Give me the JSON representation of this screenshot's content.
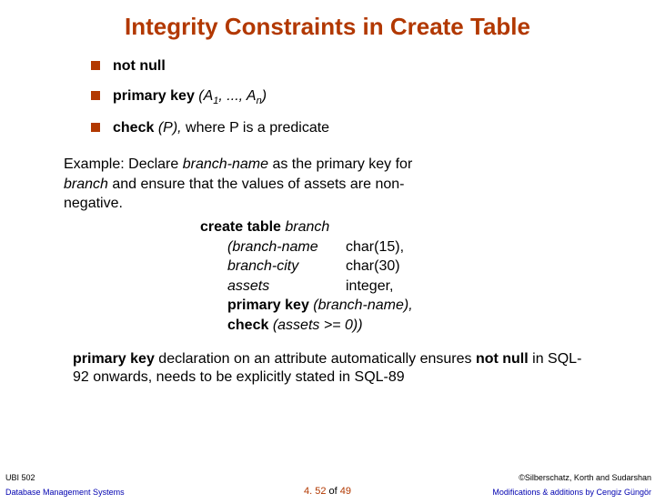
{
  "title": "Integrity Constraints in Create Table",
  "bullets": {
    "b1": "not null",
    "b2_prefix": "primary key ",
    "b2_a": "(A",
    "b2_sub1": "1",
    "b2_mid": ", ..., A",
    "b2_subn": "n",
    "b2_end": ")",
    "b3_prefix": "check ",
    "b3_italic": "(P),",
    "b3_rest": " where P is a predicate"
  },
  "example": {
    "line1_a": "Example:  Declare ",
    "line1_b": "branch-name",
    "line1_c": " as the primary key for ",
    "line2_a": "branch",
    "line2_b": " and ensure that the values of assets are non-",
    "line3": "negative."
  },
  "code": {
    "l1a": "create table ",
    "l1b": "branch",
    "l2a": "(branch-name",
    "l2b": "char(15),",
    "l3a": "branch-city",
    "l3b": "char(30)",
    "l4a": "assets",
    "l4b": "integer,",
    "l5a": "primary key ",
    "l5b": "(branch-name),",
    "l6a": "check ",
    "l6b": "(assets >= 0))"
  },
  "note": {
    "a": "primary key",
    "b": " declaration on an attribute automatically ensures ",
    "c": "not null",
    "d": " in SQL-92 onwards, needs to be explicitly stated in SQL-89"
  },
  "footer": {
    "course": "UBI 502",
    "dbms": "Database Management Systems",
    "copyright": "©Silberschatz, Korth and Sudarshan",
    "mods": "Modifications & additions by Cengiz Güngör",
    "page_a": "4. 52",
    "page_of": " of ",
    "page_b": "49"
  }
}
